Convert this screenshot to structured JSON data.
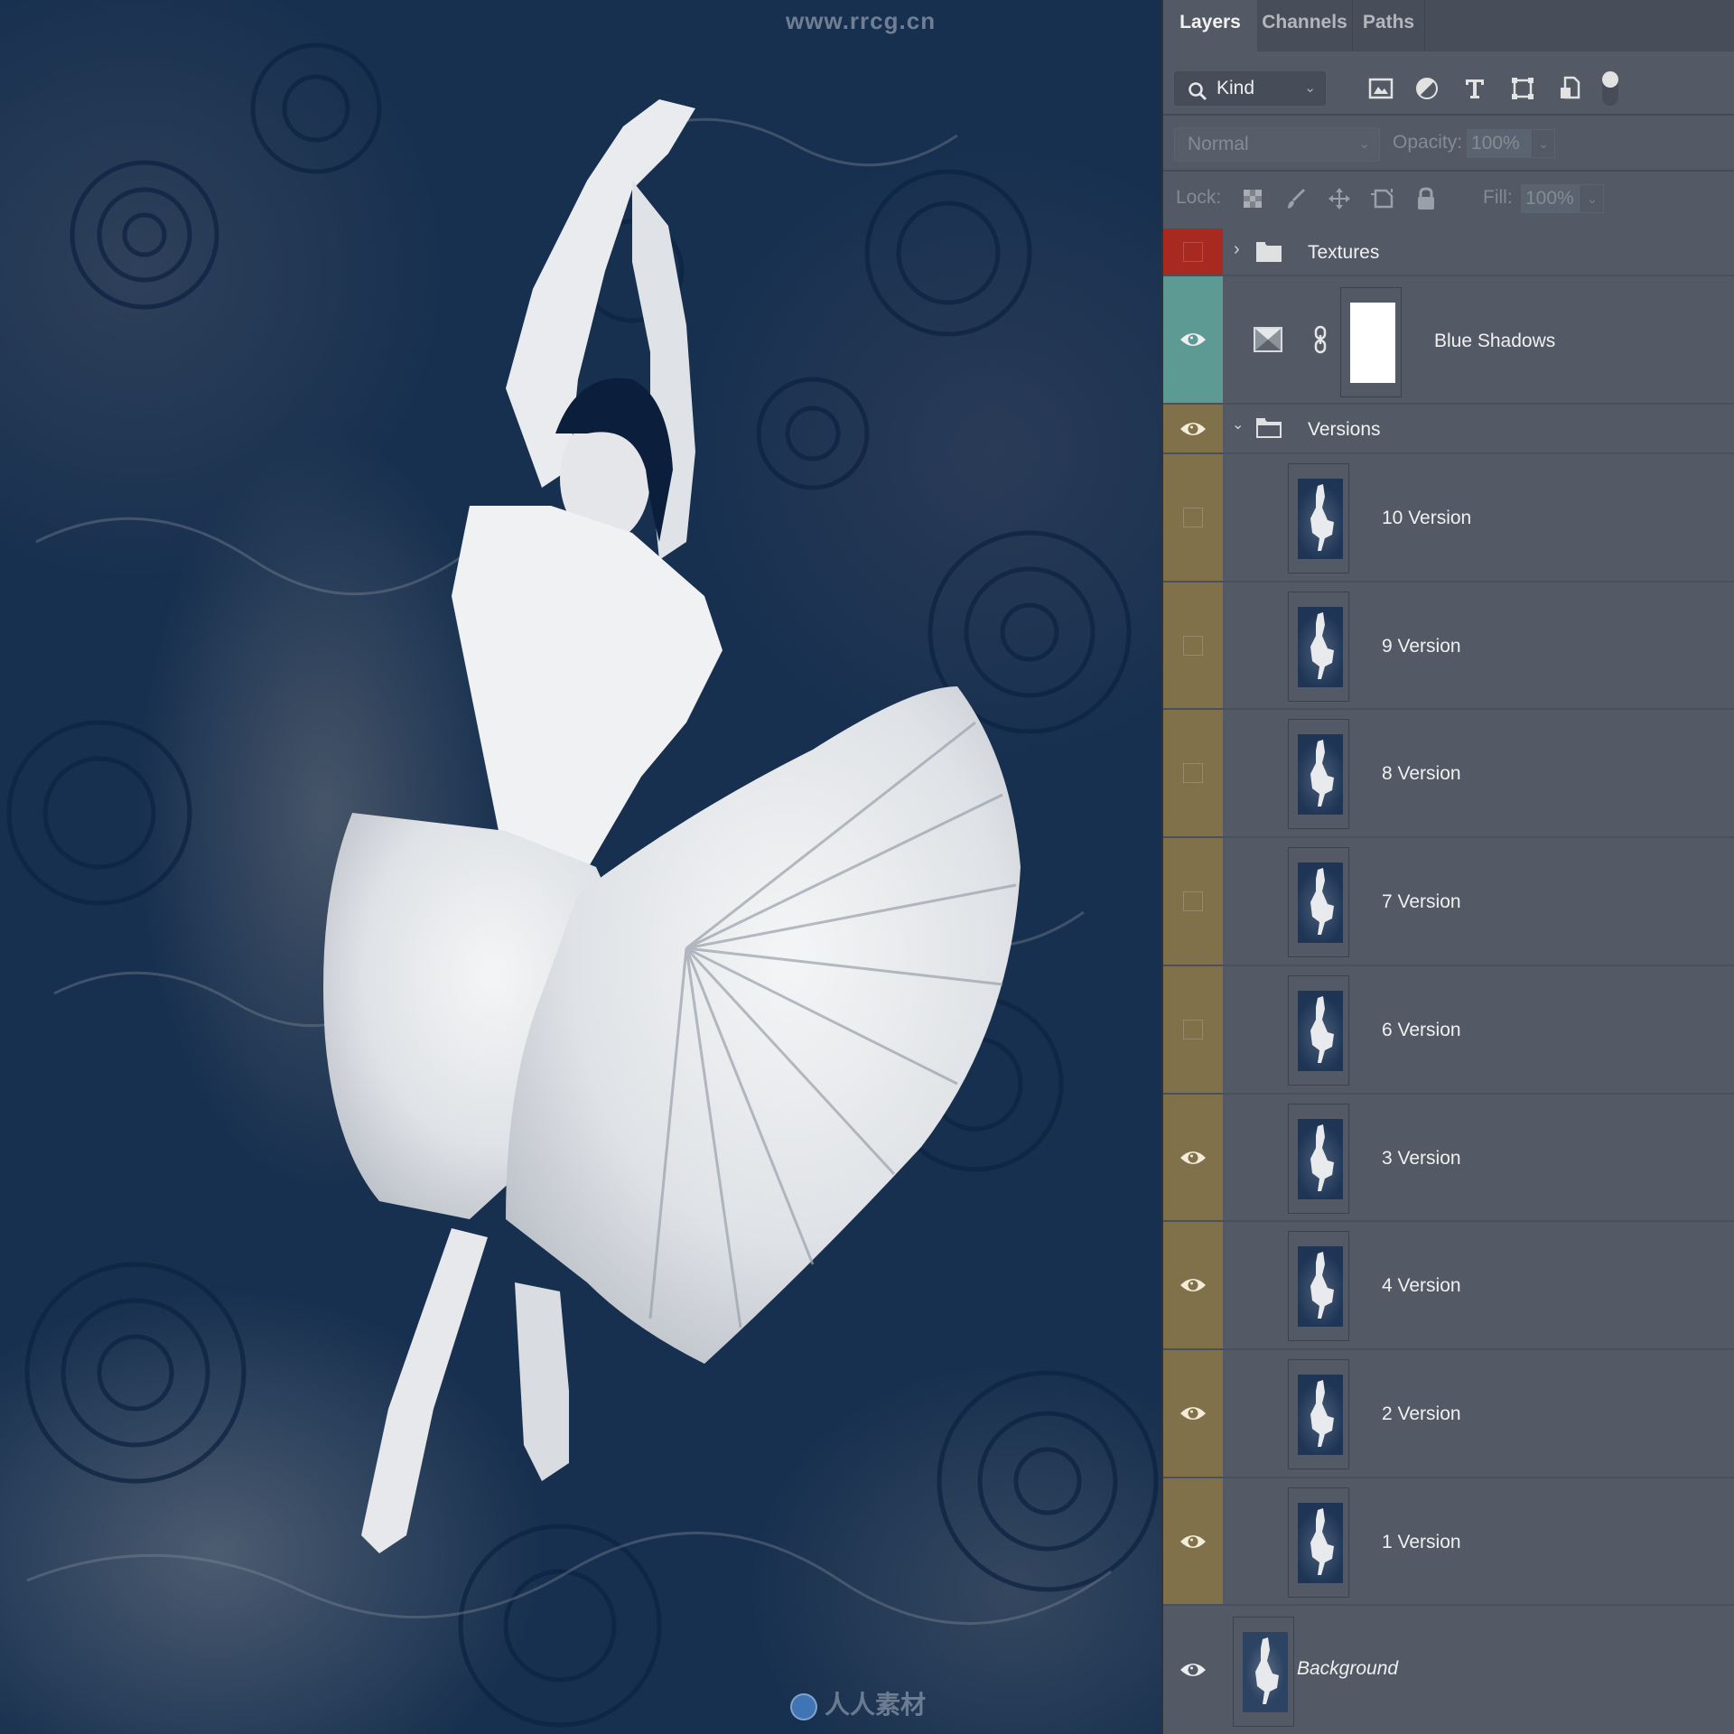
{
  "canvas": {
    "watermark_top": "www.rrcg.cn",
    "watermark_bottom": "人人素材",
    "description": "Painted dancer in white dress, blue swirled background"
  },
  "panel": {
    "tabs": [
      {
        "label": "Layers",
        "active": true
      },
      {
        "label": "Channels",
        "active": false
      },
      {
        "label": "Paths",
        "active": false
      }
    ],
    "filter": {
      "kind_label": "Kind",
      "icons": [
        "pixel-layer-filter-icon",
        "adjustment-layer-filter-icon",
        "type-layer-filter-icon",
        "shape-layer-filter-icon",
        "smart-object-filter-icon"
      ]
    },
    "blend": {
      "mode": "Normal",
      "opacity_label": "Opacity:",
      "opacity_value": "100%"
    },
    "lock": {
      "label": "Lock:",
      "icons": [
        "lock-transparent-icon",
        "lock-image-icon",
        "lock-position-icon",
        "lock-artboard-icon",
        "lock-all-icon"
      ],
      "fill_label": "Fill:",
      "fill_value": "100%"
    },
    "colors": {
      "red": "#a8291f",
      "teal": "#5c9a93",
      "olive": "#80714a"
    },
    "layers": [
      {
        "name": "Textures",
        "type": "group",
        "expanded": false,
        "visible": false,
        "color": "red"
      },
      {
        "name": "Blue Shadows",
        "type": "adjustment",
        "visible": true,
        "color": "teal"
      },
      {
        "name": "Versions",
        "type": "group",
        "expanded": true,
        "visible": true,
        "color": "olive"
      },
      {
        "name": "10 Version",
        "type": "pixel",
        "visible": false,
        "color": "olive"
      },
      {
        "name": "9 Version",
        "type": "pixel",
        "visible": false,
        "color": "olive"
      },
      {
        "name": "8 Version",
        "type": "pixel",
        "visible": false,
        "color": "olive"
      },
      {
        "name": "7 Version",
        "type": "pixel",
        "visible": false,
        "color": "olive"
      },
      {
        "name": "6 Version",
        "type": "pixel",
        "visible": false,
        "color": "olive"
      },
      {
        "name": "3 Version",
        "type": "pixel",
        "visible": true,
        "color": "olive"
      },
      {
        "name": "4 Version",
        "type": "pixel",
        "visible": true,
        "color": "olive"
      },
      {
        "name": "2 Version",
        "type": "pixel",
        "visible": true,
        "color": "olive"
      },
      {
        "name": "1 Version",
        "type": "pixel",
        "visible": true,
        "color": "olive"
      },
      {
        "name": "Background",
        "type": "background",
        "visible": true,
        "color": "none"
      }
    ]
  }
}
